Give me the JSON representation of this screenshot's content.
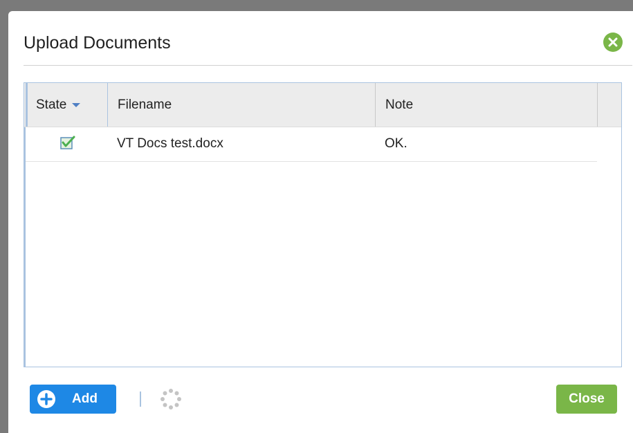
{
  "dialog": {
    "title": "Upload Documents",
    "close_icon": "close-circle-icon"
  },
  "grid": {
    "columns": [
      {
        "key": "state",
        "label": "State",
        "sorted": "desc"
      },
      {
        "key": "filename",
        "label": "Filename"
      },
      {
        "key": "note",
        "label": "Note"
      }
    ],
    "rows": [
      {
        "state_icon": "checkbox-checked-icon",
        "filename": "VT Docs test.docx",
        "note": "OK."
      }
    ]
  },
  "footer": {
    "add_label": "Add",
    "close_label": "Close",
    "spinner_icon": "loading-spinner-icon"
  },
  "colors": {
    "primary": "#1e88e5",
    "success": "#7ab648",
    "grid_border": "#a9c3e0"
  }
}
